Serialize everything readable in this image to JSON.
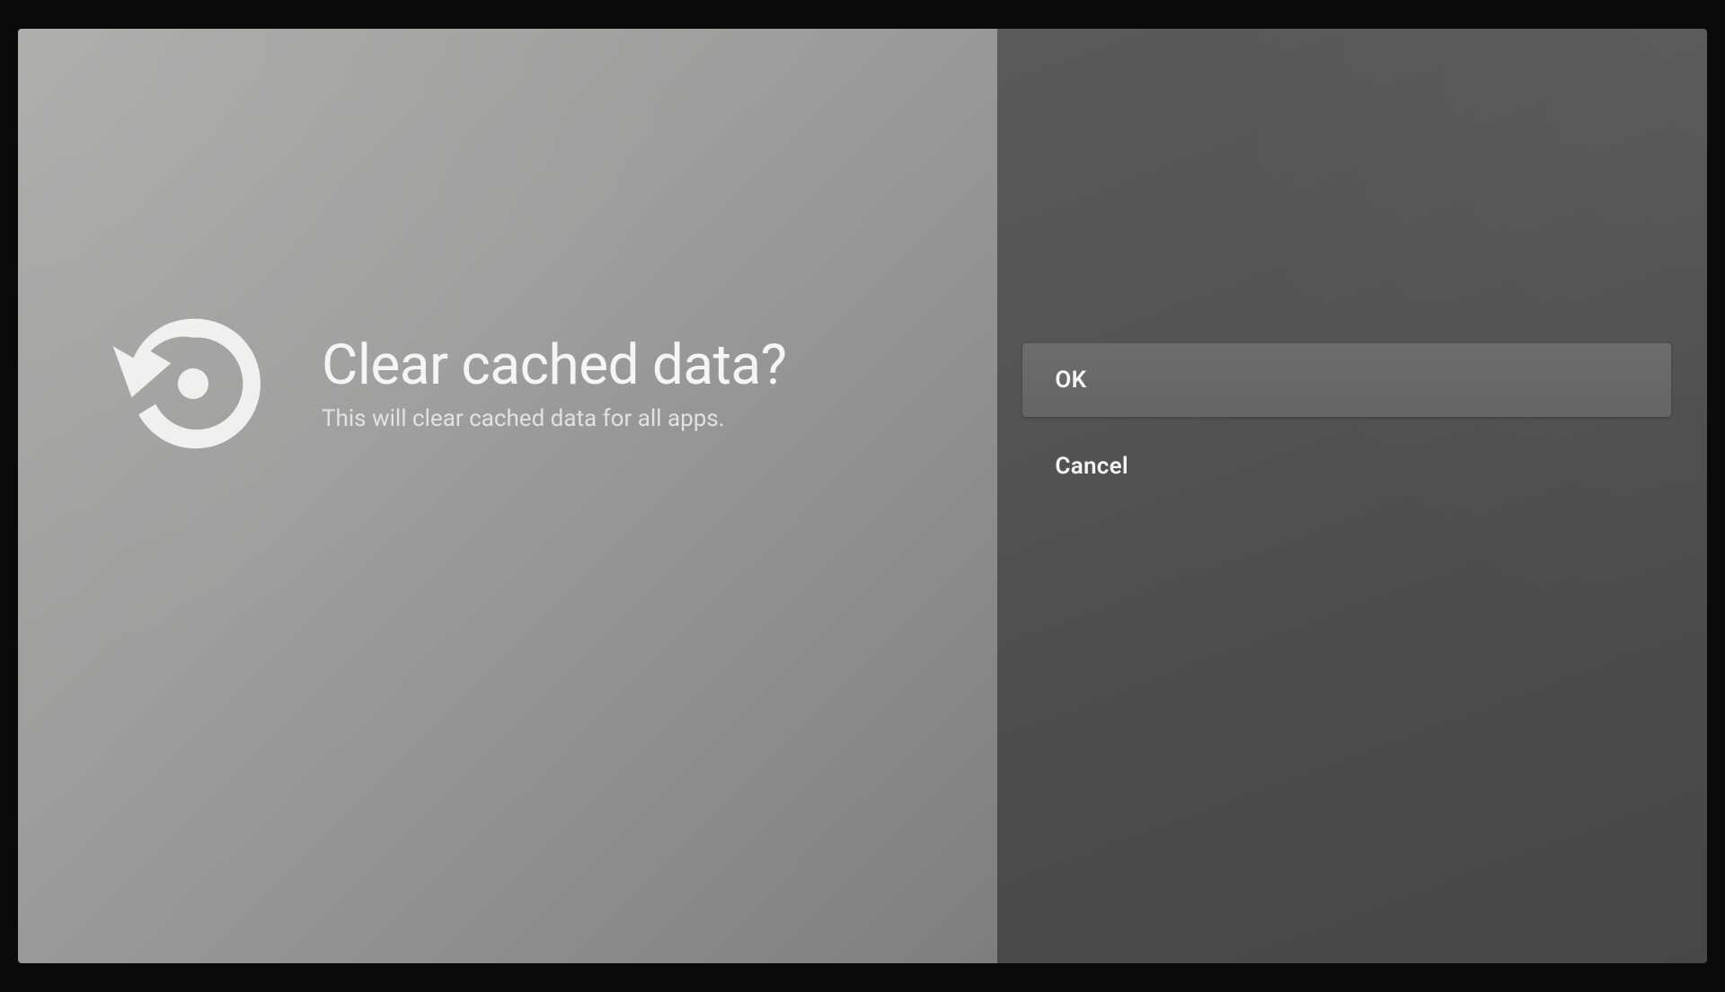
{
  "dialog": {
    "title": "Clear cached data?",
    "subtitle": "This will clear cached data for all apps.",
    "icon": "restore-icon"
  },
  "actions": {
    "ok_label": "OK",
    "cancel_label": "Cancel",
    "selected_index": 0
  }
}
